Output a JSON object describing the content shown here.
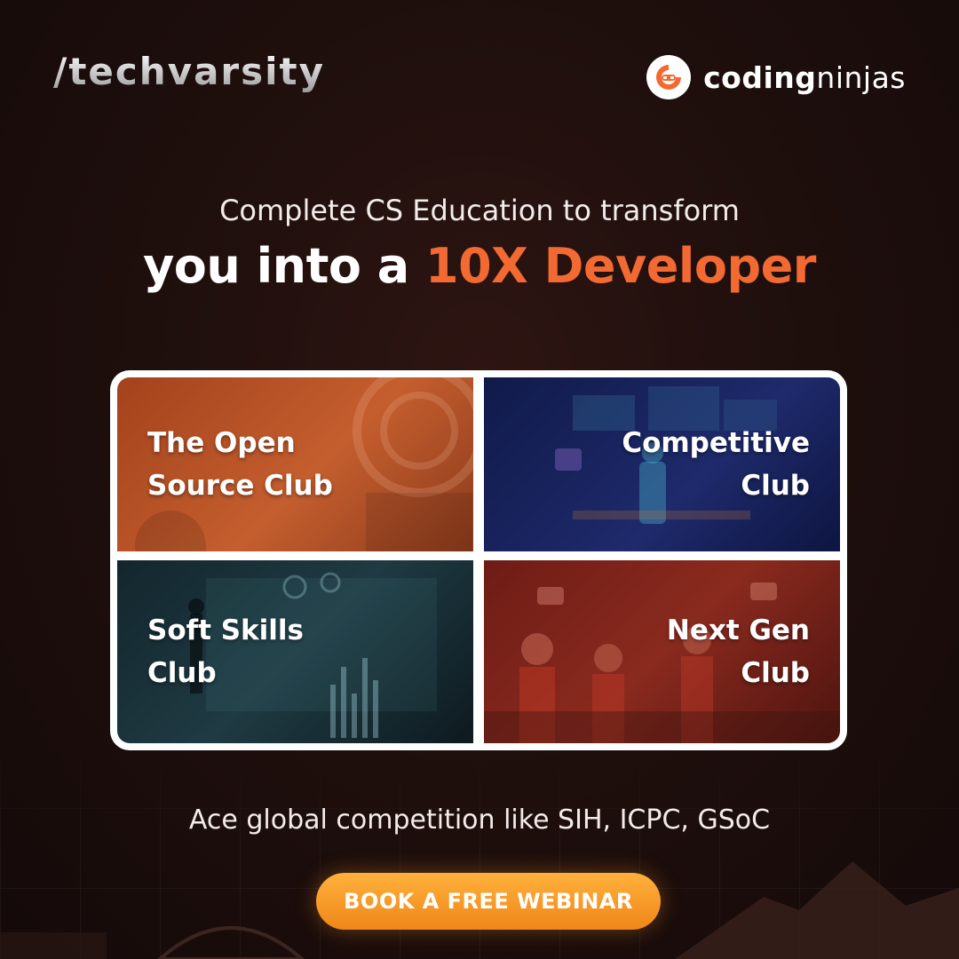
{
  "header": {
    "left_brand": "/techvarsity",
    "right_brand_bold": "coding",
    "right_brand_light": "ninjas",
    "right_logo_icon": "ninja-mask-icon"
  },
  "headline": {
    "line1": "Complete CS Education to transform",
    "line2_prefix": "you into a ",
    "line2_accent": "10X Developer"
  },
  "tiles": [
    {
      "line1": "The Open",
      "line2": "Source Club"
    },
    {
      "line1": "Competitive",
      "line2": "Club"
    },
    {
      "line1": "Soft Skills",
      "line2": "Club"
    },
    {
      "line1": "Next Gen",
      "line2": "Club"
    }
  ],
  "subline": "Ace global competition like SIH, ICPC, GSoC",
  "cta": {
    "label": "BOOK A FREE WEBINAR"
  },
  "colors": {
    "accent": "#f26a32",
    "cta": "#f59a24",
    "background": "#1f0f0d"
  }
}
